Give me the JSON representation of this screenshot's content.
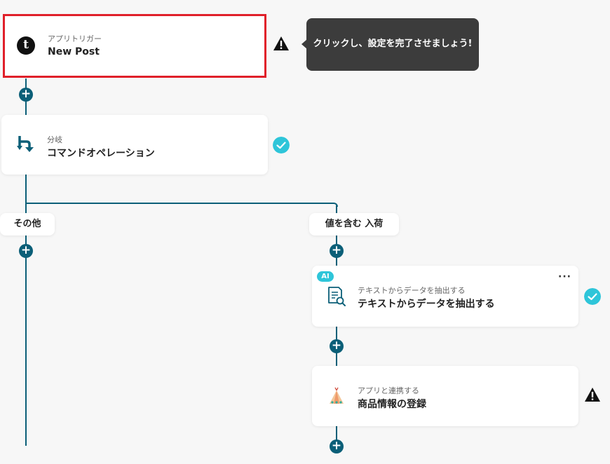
{
  "trigger": {
    "sub": "アプリトリガー",
    "title": "New Post",
    "app_icon": "tumblr-icon"
  },
  "tooltip": {
    "text": "クリックし、設定を完了させましょう!"
  },
  "branch": {
    "sub": "分岐",
    "title": "コマンドオペレーション",
    "icon": "branch-icon"
  },
  "branches": {
    "left_label": "その他",
    "right_label": "値を含む 入荷"
  },
  "extract": {
    "badge": "AI",
    "sub": "テキストからデータを抽出する",
    "title": "テキストからデータを抽出する",
    "more": "···",
    "icon": "document-search-icon"
  },
  "register": {
    "sub": "アプリと連携する",
    "title": "商品情報の登録",
    "icon": "tent-icon"
  },
  "colors": {
    "line": "#0b5f78",
    "check": "#2ec5d9",
    "highlight": "#e0202a",
    "tooltip_bg": "#3c3c3c"
  }
}
